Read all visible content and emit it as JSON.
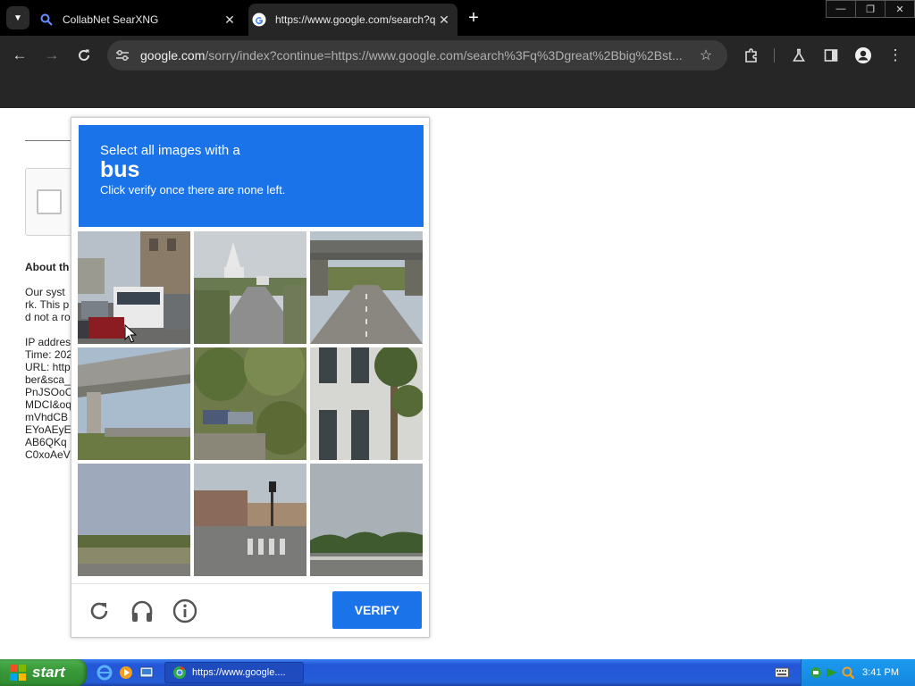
{
  "browser": {
    "tabs": [
      {
        "title": "CollabNet SearXNG",
        "active": false
      },
      {
        "title": "https://www.google.com/search?q",
        "active": true
      }
    ],
    "address": {
      "host": "google.com",
      "path": "/sorry/index?continue=https://www.google.com/search%3Fq%3Dgreat%2Bbig%2Bst..."
    },
    "window_controls": {
      "minimize": "—",
      "restore": "❐",
      "close": "✕"
    }
  },
  "page": {
    "heading": "About th",
    "lines": [
      "Our syst",
      "rk. This p",
      "d not a ro",
      "",
      "IP addres",
      "Time: 202",
      "URL: http",
      "ber&sca_",
      "PnJSOoC",
      "MDCI&oq",
      "mVhdCB",
      "EYoAEyE",
      "AB6QKq",
      "C0xoAeV"
    ]
  },
  "captcha": {
    "instruction": "Select all images with a",
    "target": "bus",
    "sub_instruction": "Click verify once there are none left.",
    "verify_label": "VERIFY",
    "tiles": [
      {
        "content": "street with bus and cars"
      },
      {
        "content": "road with white church"
      },
      {
        "content": "highway under bridge"
      },
      {
        "content": "concrete overpass"
      },
      {
        "content": "trees and parked cars"
      },
      {
        "content": "building with palm tree"
      },
      {
        "content": "field and sky"
      },
      {
        "content": "street intersection with traffic light"
      },
      {
        "content": "treeline and highway"
      }
    ],
    "icons": [
      "reload-icon",
      "audio-headphones-icon",
      "info-icon"
    ]
  },
  "taskbar": {
    "start_label": "start",
    "task_button": "https://www.google....",
    "clock": "3:41 PM"
  },
  "colors": {
    "captcha_blue": "#1a73e8",
    "chrome_dark": "#262626",
    "taskbar_blue": "#245dd8",
    "start_green": "#3a9a3a"
  }
}
